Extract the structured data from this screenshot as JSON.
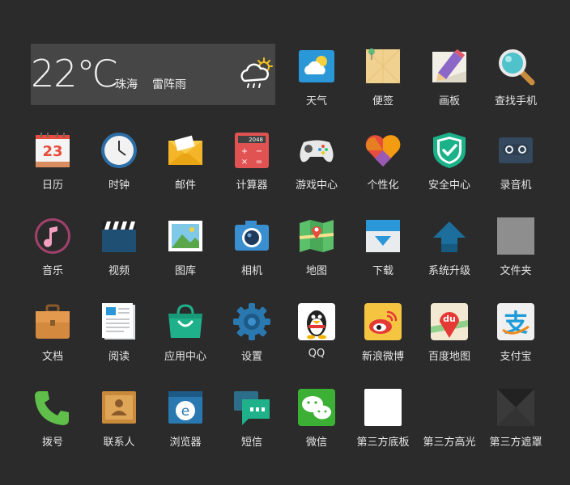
{
  "weather": {
    "temp": "22℃",
    "city": "珠海",
    "condition": "雷阵雨",
    "icon": "thunderstorm-icon"
  },
  "apps": [
    {
      "label": "天气",
      "icon": "weather-icon"
    },
    {
      "label": "便签",
      "icon": "notes-icon"
    },
    {
      "label": "画板",
      "icon": "drawing-board-icon"
    },
    {
      "label": "查找手机",
      "icon": "find-phone-icon"
    },
    {
      "label": "日历",
      "icon": "calendar-icon",
      "badge": "23"
    },
    {
      "label": "时钟",
      "icon": "clock-icon"
    },
    {
      "label": "邮件",
      "icon": "mail-icon"
    },
    {
      "label": "计算器",
      "icon": "calculator-icon",
      "display": "2048"
    },
    {
      "label": "游戏中心",
      "icon": "gamepad-icon"
    },
    {
      "label": "个性化",
      "icon": "heart-icon"
    },
    {
      "label": "安全中心",
      "icon": "shield-icon"
    },
    {
      "label": "录音机",
      "icon": "tape-recorder-icon"
    },
    {
      "label": "音乐",
      "icon": "music-icon"
    },
    {
      "label": "视频",
      "icon": "clapperboard-icon"
    },
    {
      "label": "图库",
      "icon": "gallery-icon"
    },
    {
      "label": "相机",
      "icon": "camera-icon"
    },
    {
      "label": "地图",
      "icon": "map-icon"
    },
    {
      "label": "下载",
      "icon": "download-icon"
    },
    {
      "label": "系统升级",
      "icon": "upgrade-arrow-icon"
    },
    {
      "label": "文件夹",
      "icon": "folder-placeholder-icon"
    },
    {
      "label": "文档",
      "icon": "briefcase-icon"
    },
    {
      "label": "阅读",
      "icon": "reading-icon"
    },
    {
      "label": "应用中心",
      "icon": "app-store-bag-icon"
    },
    {
      "label": "设置",
      "icon": "gear-icon"
    },
    {
      "label": "QQ",
      "icon": "qq-penguin-icon"
    },
    {
      "label": "新浪微博",
      "icon": "weibo-icon"
    },
    {
      "label": "百度地图",
      "icon": "baidu-map-icon",
      "logo_text": "du"
    },
    {
      "label": "支付宝",
      "icon": "alipay-icon",
      "logo_text": "支"
    },
    {
      "label": "拨号",
      "icon": "phone-icon"
    },
    {
      "label": "联系人",
      "icon": "contacts-icon"
    },
    {
      "label": "浏览器",
      "icon": "browser-icon",
      "logo_text": "e"
    },
    {
      "label": "短信",
      "icon": "sms-icon"
    },
    {
      "label": "微信",
      "icon": "wechat-icon"
    },
    {
      "label": "第三方底板",
      "icon": "third-party-base-icon"
    },
    {
      "label": "第三方高光",
      "icon": "third-party-highlight-icon"
    },
    {
      "label": "第三方遮罩",
      "icon": "third-party-mask-icon"
    }
  ]
}
